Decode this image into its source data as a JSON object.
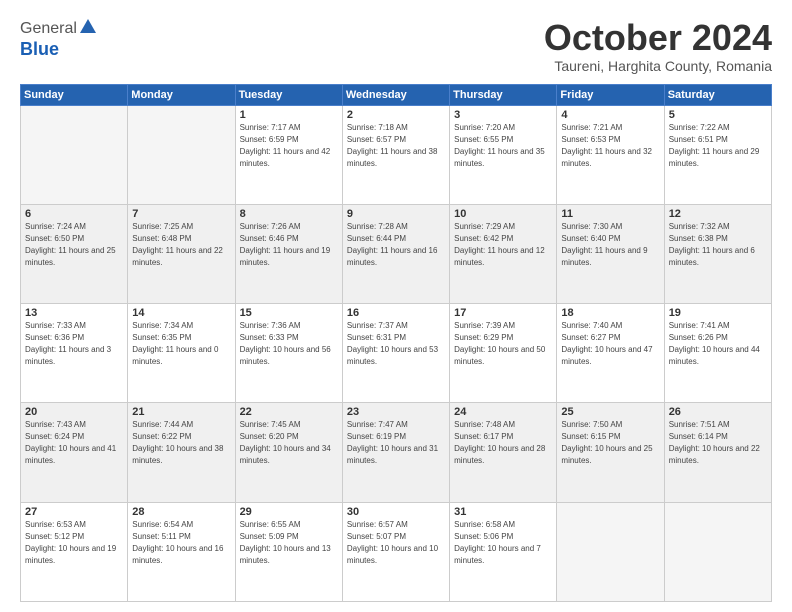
{
  "header": {
    "logo_general": "General",
    "logo_blue": "Blue",
    "month": "October 2024",
    "location": "Taureni, Harghita County, Romania"
  },
  "weekdays": [
    "Sunday",
    "Monday",
    "Tuesday",
    "Wednesday",
    "Thursday",
    "Friday",
    "Saturday"
  ],
  "weeks": [
    [
      {
        "day": "",
        "sunrise": "",
        "sunset": "",
        "daylight": ""
      },
      {
        "day": "",
        "sunrise": "",
        "sunset": "",
        "daylight": ""
      },
      {
        "day": "1",
        "sunrise": "Sunrise: 7:17 AM",
        "sunset": "Sunset: 6:59 PM",
        "daylight": "Daylight: 11 hours and 42 minutes."
      },
      {
        "day": "2",
        "sunrise": "Sunrise: 7:18 AM",
        "sunset": "Sunset: 6:57 PM",
        "daylight": "Daylight: 11 hours and 38 minutes."
      },
      {
        "day": "3",
        "sunrise": "Sunrise: 7:20 AM",
        "sunset": "Sunset: 6:55 PM",
        "daylight": "Daylight: 11 hours and 35 minutes."
      },
      {
        "day": "4",
        "sunrise": "Sunrise: 7:21 AM",
        "sunset": "Sunset: 6:53 PM",
        "daylight": "Daylight: 11 hours and 32 minutes."
      },
      {
        "day": "5",
        "sunrise": "Sunrise: 7:22 AM",
        "sunset": "Sunset: 6:51 PM",
        "daylight": "Daylight: 11 hours and 29 minutes."
      }
    ],
    [
      {
        "day": "6",
        "sunrise": "Sunrise: 7:24 AM",
        "sunset": "Sunset: 6:50 PM",
        "daylight": "Daylight: 11 hours and 25 minutes."
      },
      {
        "day": "7",
        "sunrise": "Sunrise: 7:25 AM",
        "sunset": "Sunset: 6:48 PM",
        "daylight": "Daylight: 11 hours and 22 minutes."
      },
      {
        "day": "8",
        "sunrise": "Sunrise: 7:26 AM",
        "sunset": "Sunset: 6:46 PM",
        "daylight": "Daylight: 11 hours and 19 minutes."
      },
      {
        "day": "9",
        "sunrise": "Sunrise: 7:28 AM",
        "sunset": "Sunset: 6:44 PM",
        "daylight": "Daylight: 11 hours and 16 minutes."
      },
      {
        "day": "10",
        "sunrise": "Sunrise: 7:29 AM",
        "sunset": "Sunset: 6:42 PM",
        "daylight": "Daylight: 11 hours and 12 minutes."
      },
      {
        "day": "11",
        "sunrise": "Sunrise: 7:30 AM",
        "sunset": "Sunset: 6:40 PM",
        "daylight": "Daylight: 11 hours and 9 minutes."
      },
      {
        "day": "12",
        "sunrise": "Sunrise: 7:32 AM",
        "sunset": "Sunset: 6:38 PM",
        "daylight": "Daylight: 11 hours and 6 minutes."
      }
    ],
    [
      {
        "day": "13",
        "sunrise": "Sunrise: 7:33 AM",
        "sunset": "Sunset: 6:36 PM",
        "daylight": "Daylight: 11 hours and 3 minutes."
      },
      {
        "day": "14",
        "sunrise": "Sunrise: 7:34 AM",
        "sunset": "Sunset: 6:35 PM",
        "daylight": "Daylight: 11 hours and 0 minutes."
      },
      {
        "day": "15",
        "sunrise": "Sunrise: 7:36 AM",
        "sunset": "Sunset: 6:33 PM",
        "daylight": "Daylight: 10 hours and 56 minutes."
      },
      {
        "day": "16",
        "sunrise": "Sunrise: 7:37 AM",
        "sunset": "Sunset: 6:31 PM",
        "daylight": "Daylight: 10 hours and 53 minutes."
      },
      {
        "day": "17",
        "sunrise": "Sunrise: 7:39 AM",
        "sunset": "Sunset: 6:29 PM",
        "daylight": "Daylight: 10 hours and 50 minutes."
      },
      {
        "day": "18",
        "sunrise": "Sunrise: 7:40 AM",
        "sunset": "Sunset: 6:27 PM",
        "daylight": "Daylight: 10 hours and 47 minutes."
      },
      {
        "day": "19",
        "sunrise": "Sunrise: 7:41 AM",
        "sunset": "Sunset: 6:26 PM",
        "daylight": "Daylight: 10 hours and 44 minutes."
      }
    ],
    [
      {
        "day": "20",
        "sunrise": "Sunrise: 7:43 AM",
        "sunset": "Sunset: 6:24 PM",
        "daylight": "Daylight: 10 hours and 41 minutes."
      },
      {
        "day": "21",
        "sunrise": "Sunrise: 7:44 AM",
        "sunset": "Sunset: 6:22 PM",
        "daylight": "Daylight: 10 hours and 38 minutes."
      },
      {
        "day": "22",
        "sunrise": "Sunrise: 7:45 AM",
        "sunset": "Sunset: 6:20 PM",
        "daylight": "Daylight: 10 hours and 34 minutes."
      },
      {
        "day": "23",
        "sunrise": "Sunrise: 7:47 AM",
        "sunset": "Sunset: 6:19 PM",
        "daylight": "Daylight: 10 hours and 31 minutes."
      },
      {
        "day": "24",
        "sunrise": "Sunrise: 7:48 AM",
        "sunset": "Sunset: 6:17 PM",
        "daylight": "Daylight: 10 hours and 28 minutes."
      },
      {
        "day": "25",
        "sunrise": "Sunrise: 7:50 AM",
        "sunset": "Sunset: 6:15 PM",
        "daylight": "Daylight: 10 hours and 25 minutes."
      },
      {
        "day": "26",
        "sunrise": "Sunrise: 7:51 AM",
        "sunset": "Sunset: 6:14 PM",
        "daylight": "Daylight: 10 hours and 22 minutes."
      }
    ],
    [
      {
        "day": "27",
        "sunrise": "Sunrise: 6:53 AM",
        "sunset": "Sunset: 5:12 PM",
        "daylight": "Daylight: 10 hours and 19 minutes."
      },
      {
        "day": "28",
        "sunrise": "Sunrise: 6:54 AM",
        "sunset": "Sunset: 5:11 PM",
        "daylight": "Daylight: 10 hours and 16 minutes."
      },
      {
        "day": "29",
        "sunrise": "Sunrise: 6:55 AM",
        "sunset": "Sunset: 5:09 PM",
        "daylight": "Daylight: 10 hours and 13 minutes."
      },
      {
        "day": "30",
        "sunrise": "Sunrise: 6:57 AM",
        "sunset": "Sunset: 5:07 PM",
        "daylight": "Daylight: 10 hours and 10 minutes."
      },
      {
        "day": "31",
        "sunrise": "Sunrise: 6:58 AM",
        "sunset": "Sunset: 5:06 PM",
        "daylight": "Daylight: 10 hours and 7 minutes."
      },
      {
        "day": "",
        "sunrise": "",
        "sunset": "",
        "daylight": ""
      },
      {
        "day": "",
        "sunrise": "",
        "sunset": "",
        "daylight": ""
      }
    ]
  ]
}
